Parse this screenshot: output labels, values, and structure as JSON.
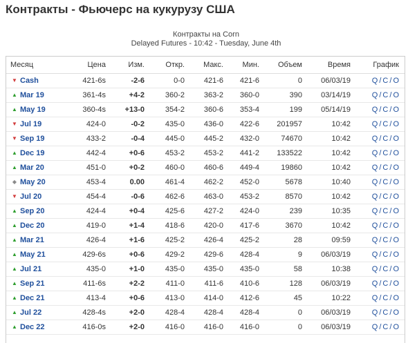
{
  "page": {
    "title": "Контракты - Фьючерс на кукурузу США"
  },
  "caption": {
    "line1": "Контракты на Corn",
    "line2": "Delayed Futures - 10:42 - Tuesday, June 4th"
  },
  "columns": {
    "month": "Месяц",
    "price": "Цена",
    "change": "Изм.",
    "open": "Откр.",
    "high": "Макс.",
    "low": "Мин.",
    "volume": "Объем",
    "time": "Время",
    "chart": "График"
  },
  "chart_links": {
    "q": "Q",
    "c": "C",
    "o": "O"
  },
  "rows": [
    {
      "month": "Cash",
      "dir": "down",
      "price": "421-6s",
      "change": "-2-6",
      "open": "0-0",
      "high": "421-6",
      "low": "421-6",
      "volume": "0",
      "time": "06/03/19"
    },
    {
      "month": "Mar 19",
      "dir": "up",
      "price": "361-4s",
      "change": "+4-2",
      "open": "360-2",
      "high": "363-2",
      "low": "360-0",
      "volume": "390",
      "time": "03/14/19"
    },
    {
      "month": "May 19",
      "dir": "up",
      "price": "360-4s",
      "change": "+13-0",
      "open": "354-2",
      "high": "360-6",
      "low": "353-4",
      "volume": "199",
      "time": "05/14/19"
    },
    {
      "month": "Jul 19",
      "dir": "down",
      "price": "424-0",
      "change": "-0-2",
      "open": "435-0",
      "high": "436-0",
      "low": "422-6",
      "volume": "201957",
      "time": "10:42"
    },
    {
      "month": "Sep 19",
      "dir": "down",
      "price": "433-2",
      "change": "-0-4",
      "open": "445-0",
      "high": "445-2",
      "low": "432-0",
      "volume": "74670",
      "time": "10:42"
    },
    {
      "month": "Dec 19",
      "dir": "up",
      "price": "442-4",
      "change": "+0-6",
      "open": "453-2",
      "high": "453-2",
      "low": "441-2",
      "volume": "133522",
      "time": "10:42"
    },
    {
      "month": "Mar 20",
      "dir": "up",
      "price": "451-0",
      "change": "+0-2",
      "open": "460-0",
      "high": "460-6",
      "low": "449-4",
      "volume": "19860",
      "time": "10:42"
    },
    {
      "month": "May 20",
      "dir": "flat",
      "price": "453-4",
      "change": "0.00",
      "open": "461-4",
      "high": "462-2",
      "low": "452-0",
      "volume": "5678",
      "time": "10:40"
    },
    {
      "month": "Jul 20",
      "dir": "down",
      "price": "454-4",
      "change": "-0-6",
      "open": "462-6",
      "high": "463-0",
      "low": "453-2",
      "volume": "8570",
      "time": "10:42"
    },
    {
      "month": "Sep 20",
      "dir": "up",
      "price": "424-4",
      "change": "+0-4",
      "open": "425-6",
      "high": "427-2",
      "low": "424-0",
      "volume": "239",
      "time": "10:35"
    },
    {
      "month": "Dec 20",
      "dir": "up",
      "price": "419-0",
      "change": "+1-4",
      "open": "418-6",
      "high": "420-0",
      "low": "417-6",
      "volume": "3670",
      "time": "10:42"
    },
    {
      "month": "Mar 21",
      "dir": "up",
      "price": "426-4",
      "change": "+1-6",
      "open": "425-2",
      "high": "426-4",
      "low": "425-2",
      "volume": "28",
      "time": "09:59"
    },
    {
      "month": "May 21",
      "dir": "up",
      "price": "429-6s",
      "change": "+0-6",
      "open": "429-2",
      "high": "429-6",
      "low": "428-4",
      "volume": "9",
      "time": "06/03/19"
    },
    {
      "month": "Jul 21",
      "dir": "up",
      "price": "435-0",
      "change": "+1-0",
      "open": "435-0",
      "high": "435-0",
      "low": "435-0",
      "volume": "58",
      "time": "10:38"
    },
    {
      "month": "Sep 21",
      "dir": "up",
      "price": "411-6s",
      "change": "+2-2",
      "open": "411-0",
      "high": "411-6",
      "low": "410-6",
      "volume": "128",
      "time": "06/03/19"
    },
    {
      "month": "Dec 21",
      "dir": "up",
      "price": "413-4",
      "change": "+0-6",
      "open": "413-0",
      "high": "414-0",
      "low": "412-6",
      "volume": "45",
      "time": "10:22"
    },
    {
      "month": "Jul 22",
      "dir": "up",
      "price": "428-4s",
      "change": "+2-0",
      "open": "428-4",
      "high": "428-4",
      "low": "428-4",
      "volume": "0",
      "time": "06/03/19"
    },
    {
      "month": "Dec 22",
      "dir": "up",
      "price": "416-0s",
      "change": "+2-0",
      "open": "416-0",
      "high": "416-0",
      "low": "416-0",
      "volume": "0",
      "time": "06/03/19"
    }
  ],
  "icons": {
    "up": "arrow-up-icon",
    "down": "arrow-down-icon",
    "flat": "diamond-icon"
  },
  "colors": {
    "up": "#2e9e2e",
    "down": "#d23c3c",
    "link": "#1f4f9c"
  }
}
